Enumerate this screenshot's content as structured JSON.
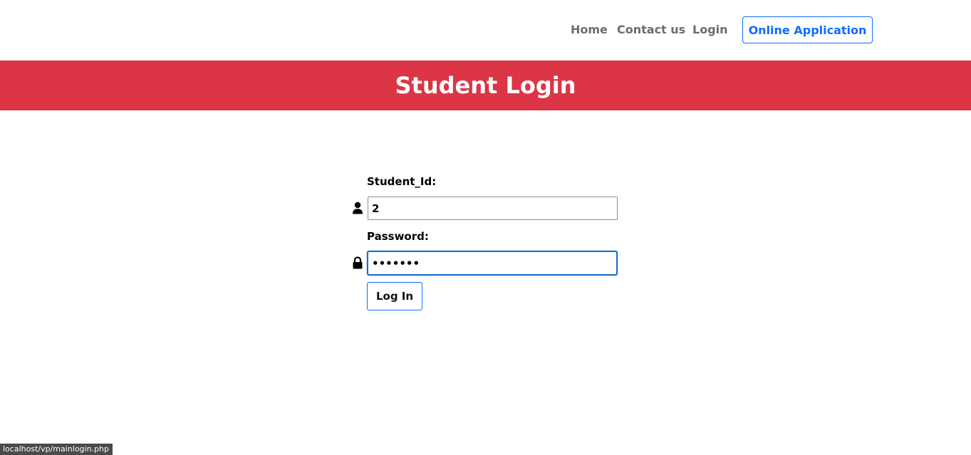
{
  "nav": {
    "home": "Home",
    "contact": "Contact us",
    "login": "Login",
    "apply": "Online Application"
  },
  "banner": {
    "title": "Student Login"
  },
  "form": {
    "student_id_label": "Student_Id:",
    "student_id_value": "2",
    "password_label": "Password:",
    "password_value": "1234567",
    "submit_label": "Log In"
  },
  "status_bar": {
    "url": "localhost/vp/mainlogin.php"
  },
  "colors": {
    "banner": "#dc3545",
    "accent": "#0d6efd",
    "nav_text": "#6c6c6c"
  },
  "icons": {
    "student_id": "user-icon",
    "password": "lock-icon"
  }
}
